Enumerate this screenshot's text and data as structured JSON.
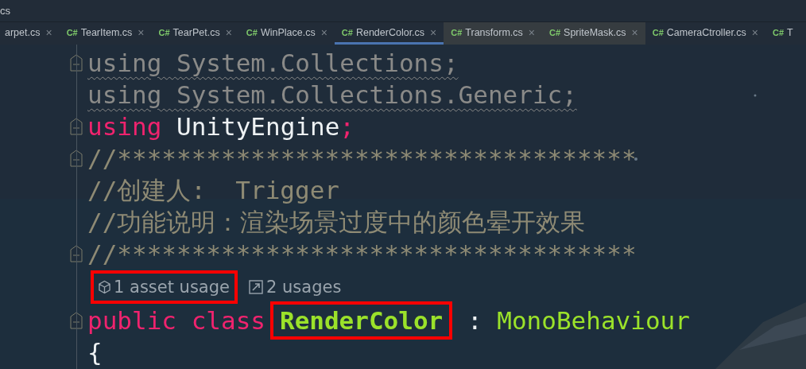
{
  "title_bar": {
    "text": "cs"
  },
  "tabs": [
    {
      "label": "arpet.cs",
      "selected": false,
      "shaded": false
    },
    {
      "icon": "C#",
      "label": "TearItem.cs",
      "selected": false,
      "shaded": false
    },
    {
      "icon": "C#",
      "label": "TearPet.cs",
      "selected": false,
      "shaded": false
    },
    {
      "icon": "C#",
      "label": "WinPlace.cs",
      "selected": false,
      "shaded": false
    },
    {
      "icon": "C#",
      "label": "RenderColor.cs",
      "selected": true,
      "shaded": false
    },
    {
      "icon": "C#",
      "label": "Transform.cs",
      "selected": false,
      "shaded": true
    },
    {
      "icon": "C#",
      "label": "SpriteMask.cs",
      "selected": false,
      "shaded": true
    },
    {
      "icon": "C#",
      "label": "CameraCtroller.cs",
      "selected": false,
      "shaded": false
    },
    {
      "icon": "C#",
      "label": "T",
      "selected": false,
      "shaded": false
    }
  ],
  "close_glyph": "×",
  "code_lines": [
    {
      "kind": "code",
      "fold": true,
      "tokens": [
        {
          "text": "using System.Collections;",
          "kind": "unused"
        }
      ]
    },
    {
      "kind": "code",
      "fold": false,
      "tokens": [
        {
          "text": "using System.Collections.Generic;",
          "kind": "unused"
        }
      ]
    },
    {
      "kind": "code",
      "fold": true,
      "tokens": [
        {
          "text": "using",
          "kind": "keyword"
        },
        {
          "text": " UnityEngine",
          "kind": "plain"
        },
        {
          "text": ";",
          "kind": "keyword"
        }
      ]
    },
    {
      "kind": "code",
      "fold": true,
      "tokens": [
        {
          "text": "//***********************************",
          "kind": "comment"
        }
      ]
    },
    {
      "kind": "code",
      "fold": false,
      "tokens": [
        {
          "text": "//创建人:  Trigger",
          "kind": "comment"
        }
      ]
    },
    {
      "kind": "code",
      "fold": false,
      "tokens": [
        {
          "text": "//功能说明：渲染场景过度中的颜色晕开效果",
          "kind": "comment"
        }
      ]
    },
    {
      "kind": "code",
      "fold": true,
      "tokens": [
        {
          "text": "//***********************************",
          "kind": "comment"
        }
      ]
    },
    {
      "kind": "codelens",
      "fold": false,
      "items": [
        {
          "kind": "asset",
          "text": "1 asset usage",
          "highlighted": true
        },
        {
          "kind": "usages",
          "text": "2 usages",
          "highlighted": false
        }
      ]
    },
    {
      "kind": "code",
      "fold": true,
      "tokens": [
        {
          "text": "public",
          "kind": "keyword"
        },
        {
          "text": " class",
          "kind": "keyword"
        },
        {
          "text": "RenderColor",
          "kind": "classname",
          "highlighted": true
        },
        {
          "text": " :",
          "kind": "plain"
        },
        {
          "text": " MonoBehaviour",
          "kind": "type"
        }
      ]
    },
    {
      "kind": "code",
      "fold": false,
      "tokens": [
        {
          "text": "{",
          "kind": "plain"
        }
      ]
    }
  ]
}
